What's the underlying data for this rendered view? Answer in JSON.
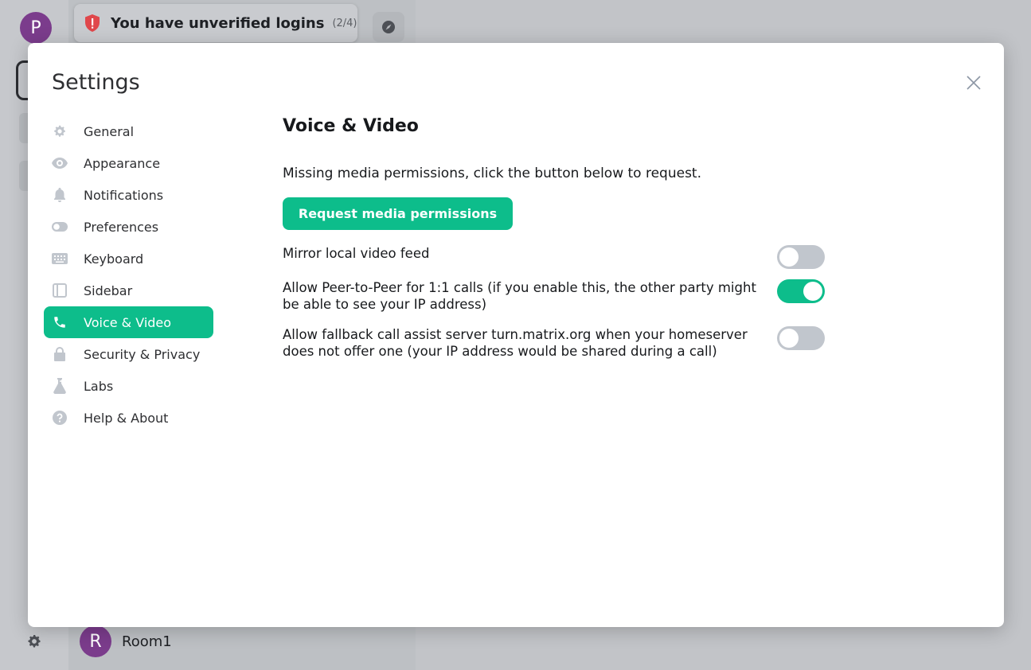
{
  "background": {
    "user_avatar_letter": "P",
    "toast": {
      "title": "You have unverified logins",
      "count": "(2/4)"
    },
    "room": {
      "avatar_letter": "R",
      "name": "Room1"
    }
  },
  "dialog": {
    "title": "Settings",
    "nav": [
      {
        "label": "General",
        "icon": "gear-icon"
      },
      {
        "label": "Appearance",
        "icon": "eye-icon"
      },
      {
        "label": "Notifications",
        "icon": "bell-icon"
      },
      {
        "label": "Preferences",
        "icon": "toggle-icon"
      },
      {
        "label": "Keyboard",
        "icon": "keyboard-icon"
      },
      {
        "label": "Sidebar",
        "icon": "sidebar-icon"
      },
      {
        "label": "Voice & Video",
        "icon": "phone-icon",
        "active": true
      },
      {
        "label": "Security & Privacy",
        "icon": "lock-icon"
      },
      {
        "label": "Labs",
        "icon": "flask-icon"
      },
      {
        "label": "Help & About",
        "icon": "help-icon"
      }
    ],
    "content": {
      "title": "Voice & Video",
      "description": "Missing media permissions, click the button below to request.",
      "request_button": "Request media permissions",
      "settings": [
        {
          "label": "Mirror local video feed",
          "enabled": false
        },
        {
          "label": "Allow Peer-to-Peer for 1:1 calls (if you enable this, the other party might be able to see your IP address)",
          "enabled": true
        },
        {
          "label": "Allow fallback call assist server turn.matrix.org when your homeserver does not offer one (your IP address would be shared during a call)",
          "enabled": false
        }
      ]
    }
  },
  "colors": {
    "accent": "#0dbd8b",
    "toggle_off": "#c1c6cd",
    "avatar": "#7b3c8c",
    "shield": "#e0474b"
  }
}
